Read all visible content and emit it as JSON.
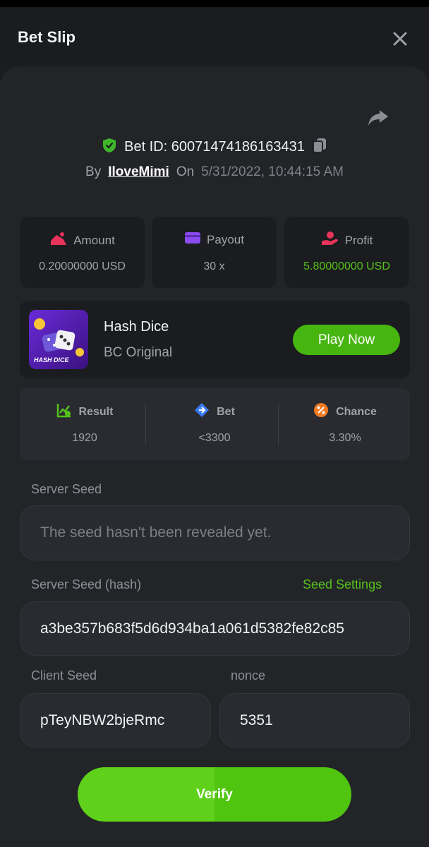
{
  "header": {
    "title": "Bet Slip",
    "close_icon": "close-icon"
  },
  "bet": {
    "id_label": "Bet ID: 60071474186163431",
    "by_label": "By",
    "username": "IloveMimi",
    "on_label": "On",
    "datetime": "5/31/2022, 10:44:15 AM"
  },
  "stats": [
    {
      "label": "Amount",
      "value": "0.20000000 USD",
      "icon": "amount-icon",
      "color": "#e8345a"
    },
    {
      "label": "Payout",
      "value": "30 x",
      "icon": "payout-icon",
      "color": "#8a4cf0"
    },
    {
      "label": "Profit",
      "value": "5.80000000 USD",
      "icon": "profit-icon",
      "color": "#e8345a"
    }
  ],
  "game": {
    "name": "Hash Dice",
    "provider": "BC Original",
    "thumb_text": "HASH DICE",
    "play_label": "Play Now"
  },
  "result": [
    {
      "label": "Result",
      "value": "1920",
      "icon": "result-chart-icon",
      "color": "#55c21b"
    },
    {
      "label": "Bet",
      "value": "<3300",
      "icon": "bet-tag-icon",
      "color": "#3a7bf0"
    },
    {
      "label": "Chance",
      "value": "3.30%",
      "icon": "chance-percent-icon",
      "color": "#f07a22"
    }
  ],
  "server_seed": {
    "label": "Server Seed",
    "placeholder": "The seed hasn't been revealed yet."
  },
  "server_seed_hash": {
    "label": "Server Seed (hash)",
    "value": "a3be357b683f5d6d934ba1a061d5382fe82c85",
    "settings_label": "Seed Settings"
  },
  "client_seed": {
    "label": "Client Seed",
    "value": "pTeyNBW2bjeRmc"
  },
  "nonce": {
    "label": "nonce",
    "value": "5351"
  },
  "verify_label": "Verify",
  "colors": {
    "accent": "#55c21b",
    "background": "#1b1c1f",
    "panel": "#232428"
  }
}
